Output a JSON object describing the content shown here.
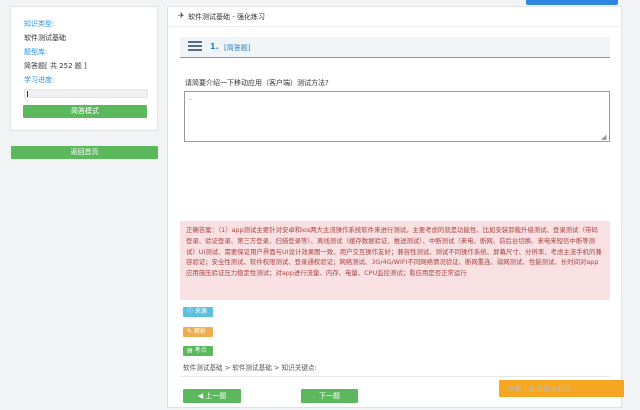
{
  "sidebar": {
    "knowledge_type_label": "知识类型:",
    "knowledge_type_value": "软件测试基础",
    "question_bank_label": "题型库:",
    "question_bank_value": "简答题[ 共 252 题 ]",
    "progress_label": "学习进度:",
    "progress_fraction": 0.0,
    "mode_button": "简答模式",
    "back_button": "返回首页"
  },
  "main": {
    "header_title": "软件测试基础 - 强化练习",
    "question_number": "1.",
    "question_type": "[简答题]",
    "question_text": "请简要介绍一下移动应用（客户端）测试方法?",
    "answer_value": "·",
    "correct_answer": "正确答案：（1）app测试主要针对安卓和ios两大主流操作系统软件来进行测试。主要考虑的就是功能性、比如安装卸载升级测试、登录测试（带码登录、验证登录、第三方登录、扫描登录等）、离线测试（缓存数据验证、推送测试）、中断测试（来电、断网、前后台切换、来电来短信中断等测试）UI测试、需要保证用户界面与UI设计效果图一致、用户交互操作友好；兼容性测试、测试不同操作系统、屏幕尺寸、分辨率、考虑主流手机的兼容验证；安全性测试、软件权限测试、登录通权验证；网络测试、3G/4G/WIFI不同网络情况验证、断网重连、弱网测试、性能测试、长时间对app应用施压验证压力稳定性测试；对app进行流量、内存、电量、CPU监控测试；看应用是否正常运行",
    "tag_source": "来源",
    "tag_analysis": "解析",
    "tag_point": "考点",
    "breadcrumb": "软件测试基础 > 软件测试基础 > 知识关键点:",
    "prev_button": "上一题",
    "next_button": "下一题",
    "watermark": "@稀土掘金技术社区"
  },
  "colors": {
    "green": "#5cb85c",
    "link_blue": "#2f8fd6",
    "answer_bg": "#f9e1e3",
    "answer_text": "#a94442",
    "orange": "#f5a623"
  },
  "icons": {
    "header": "paper-plane-icon",
    "question": "list-icon",
    "source": "info-icon",
    "analysis": "edit-icon",
    "point": "book-icon",
    "prev": "left-arrow-icon"
  }
}
